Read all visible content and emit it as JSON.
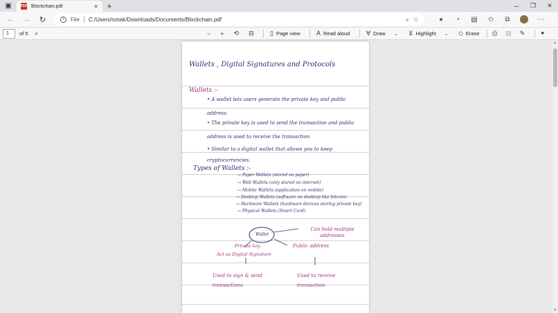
{
  "tab": {
    "title": "Blockchain.pdf"
  },
  "address": {
    "scheme": "File",
    "path": "C:/Users/ronak/Downloads/Documents/Blockchain.pdf"
  },
  "toolbar": {
    "page_current": "1",
    "page_total": "of 5",
    "page_view": "Page view",
    "read_aloud": "Read aloud",
    "draw": "Draw",
    "highlight": "Highlight",
    "erase": "Erase"
  },
  "note": {
    "title": "Wallets , Digital Signatures and Protocols",
    "section1": "Wallets :-",
    "bullets": [
      "A wallet lets users generate the private key and public address.",
      "The private key is used to send the transaction and public address is used to receive the transaction",
      "Similar to a digital wallet that allows you to keep cryptocurrencies."
    ],
    "section2": "Types of Wallets :-",
    "types": [
      "Paper Wallets (stored on paper)",
      "Web Wallets (only stored on internet)",
      "Mobile Wallets (application on mobile)",
      "Desktop Wallets (software on desktop like bitcoin)",
      "Hardware Wallets (hardware devices storing private key)",
      "Physical Wallets (Smart Card)"
    ],
    "diagram": {
      "center": "Wallet",
      "right_top": "Can hold multiple addresses",
      "left": "Private key",
      "left_sub": "Act as Digital Signature",
      "right": "Public address",
      "bottom_left": "Used to sign & send transactions",
      "bottom_right": "Used to receive transaction"
    }
  }
}
